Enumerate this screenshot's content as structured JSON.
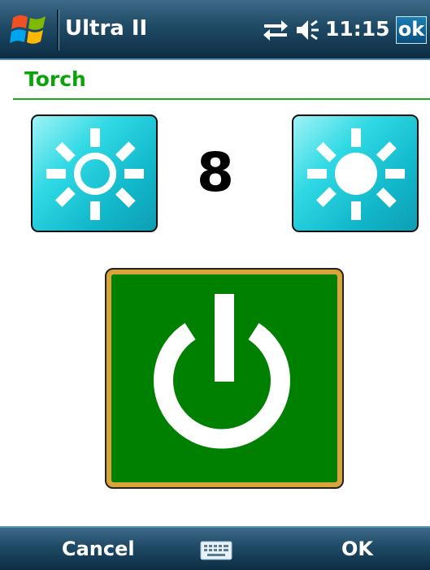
{
  "titlebar": {
    "app_title": "Ultra II",
    "clock": "11:15",
    "ok_label": "ok",
    "icons": [
      "windows-start-icon",
      "connectivity-icon",
      "volume-icon"
    ]
  },
  "page": {
    "title": "Torch",
    "brightness_level": "8",
    "accent_color": "#0aa30a",
    "brightness_button_color": "#2fd9e4",
    "power_button_color": "#008000",
    "icons": [
      "brightness-decrease-icon",
      "brightness-increase-icon",
      "power-icon"
    ]
  },
  "softbar": {
    "left_label": "Cancel",
    "right_label": "OK",
    "icons": [
      "keyboard-icon"
    ]
  }
}
